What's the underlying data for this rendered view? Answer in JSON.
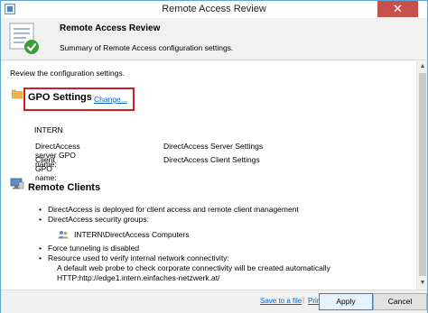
{
  "window": {
    "title": "Remote Access Review",
    "close_label": "✕"
  },
  "header": {
    "title": "Remote Access Review",
    "subtitle": "Summary of Remote Access configuration settings."
  },
  "content": {
    "intro": "Review the configuration settings.",
    "gpo": {
      "heading": "GPO Settings",
      "change_link": "Change...",
      "domain": "INTERN",
      "rows": [
        {
          "label": "DirectAccess server GPO name:",
          "value": "DirectAccess Server Settings"
        },
        {
          "label": "Client GPO name:",
          "value": "DirectAccess Client Settings"
        }
      ]
    },
    "remote_clients": {
      "heading": "Remote Clients",
      "bullets": [
        "DirectAccess is deployed for client access and remote client management",
        "DirectAccess security groups:",
        "Force tunneling is disabled",
        "Resource used to verify internal network connectivity:"
      ],
      "security_group": "INTERN\\DirectAccess Computers",
      "probe_line1": "A default web probe to check corporate connectivity will be created automatically",
      "probe_line2": "HTTP:http://edge1.intern.einfaches-netzwerk.at/"
    }
  },
  "footer": {
    "save_link": "Save to a file",
    "separator": "|",
    "print_link": "Print",
    "apply_label": "Apply",
    "cancel_label": "Cancel"
  },
  "icons": {
    "app": "window-app-icon",
    "header": "review-checklist-icon",
    "gpo": "folder-icon",
    "remote_clients": "computer-icon",
    "group": "user-group-icon"
  },
  "colors": {
    "highlight_border": "#cc1f1f",
    "link": "#0066cc",
    "close_button": "#c7504b",
    "window_border": "#5fa6d6"
  }
}
